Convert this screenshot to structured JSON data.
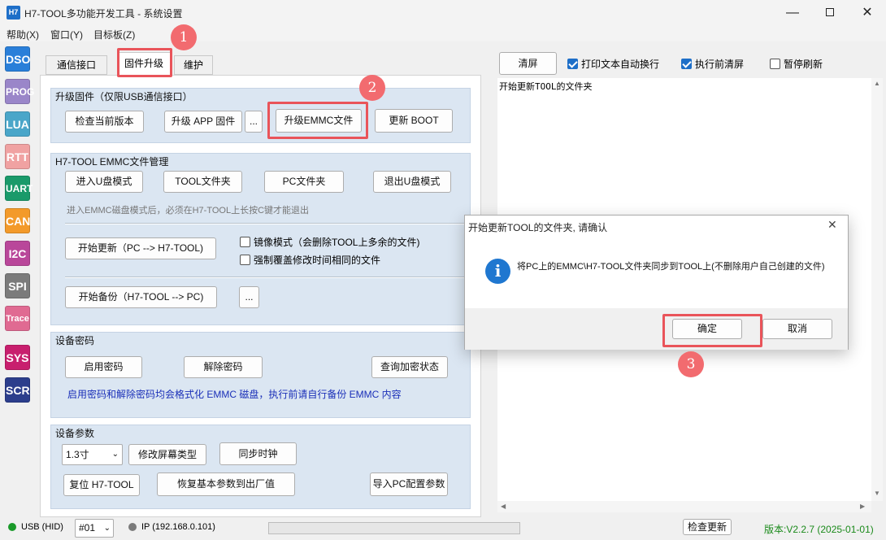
{
  "window": {
    "icon_text": "H7",
    "title": "H7-TOOL多功能开发工具 - 系统设置"
  },
  "menu": [
    "帮助(X)",
    "窗口(Y)",
    "目标板(Z)"
  ],
  "sidebar": [
    {
      "label": "DSO",
      "color": "#2a7fd9"
    },
    {
      "label": "PROG",
      "color": "#9a86c9"
    },
    {
      "label": "LUA",
      "color": "#4aa6c9"
    },
    {
      "label": "RTT",
      "color": "#f0a2a2"
    },
    {
      "label": "UART",
      "color": "#1a9a6a"
    },
    {
      "label": "CAN",
      "color": "#f39a2a"
    },
    {
      "label": "I2C",
      "color": "#b9479a"
    },
    {
      "label": "SPI",
      "color": "#7b7b7b"
    },
    {
      "label": "Trace",
      "color": "#e06a92"
    },
    {
      "label": "SYS",
      "color": "#c81f6e"
    },
    {
      "label": "SCR",
      "color": "#2c3e8c"
    }
  ],
  "tabs": {
    "comm": "通信接口",
    "upgrade": "固件升级",
    "maint": "维护"
  },
  "upgrade": {
    "title": "升级固件（仅限USB通信接口）",
    "check": "检查当前版本",
    "app": "升级 APP 固件",
    "dots": "...",
    "emmc": "升级EMMC文件",
    "boot": "更新 BOOT"
  },
  "emmc": {
    "title": "H7-TOOL EMMC文件管理",
    "udisk": "进入U盘模式",
    "toolfolder": "TOOL文件夹",
    "pcfolder": "PC文件夹",
    "exit": "退出U盘模式",
    "note": "进入EMMC磁盘模式后，必须在H7-TOOL上长按C键才能退出",
    "start_update": "开始更新（PC --> H7-TOOL)",
    "mirror": "镜像模式（会删除TOOL上多余的文件)",
    "force": "强制覆盖修改时间相同的文件",
    "start_backup": "开始备份（H7-TOOL --> PC)",
    "dots": "..."
  },
  "password": {
    "title": "设备密码",
    "enable": "启用密码",
    "disable": "解除密码",
    "query": "查询加密状态",
    "note": "启用密码和解除密码均会格式化 EMMC 磁盘，执行前请自行备份 EMMC 内容"
  },
  "params": {
    "title": "设备参数",
    "size": "1.3寸",
    "change_screen": "修改屏幕类型",
    "sync_clock": "同步时钟",
    "reset": "复位 H7-TOOL",
    "restore": "恢复基本参数到出厂值",
    "import": "导入PC配置参数"
  },
  "right": {
    "clear": "清屏",
    "wrap": "打印文本自动换行",
    "clear_before": "执行前清屏",
    "pause": "暂停刷新",
    "log": "开始更新TOOL的文件夹"
  },
  "status": {
    "usb": "USB (HID)",
    "port": "#01",
    "ip": "IP (192.168.0.101)",
    "check_update": "检查更新",
    "version": "版本:V2.2.7 (2025-01-01)"
  },
  "dialog": {
    "title": "开始更新TOOL的文件夹, 请确认",
    "icon": "i",
    "message": "将PC上的EMMC\\H7-TOOL文件夹同步到TOOL上(不删除用户自己创建的文件)",
    "ok": "确定",
    "cancel": "取消"
  },
  "annotations": [
    "1",
    "2",
    "3"
  ]
}
